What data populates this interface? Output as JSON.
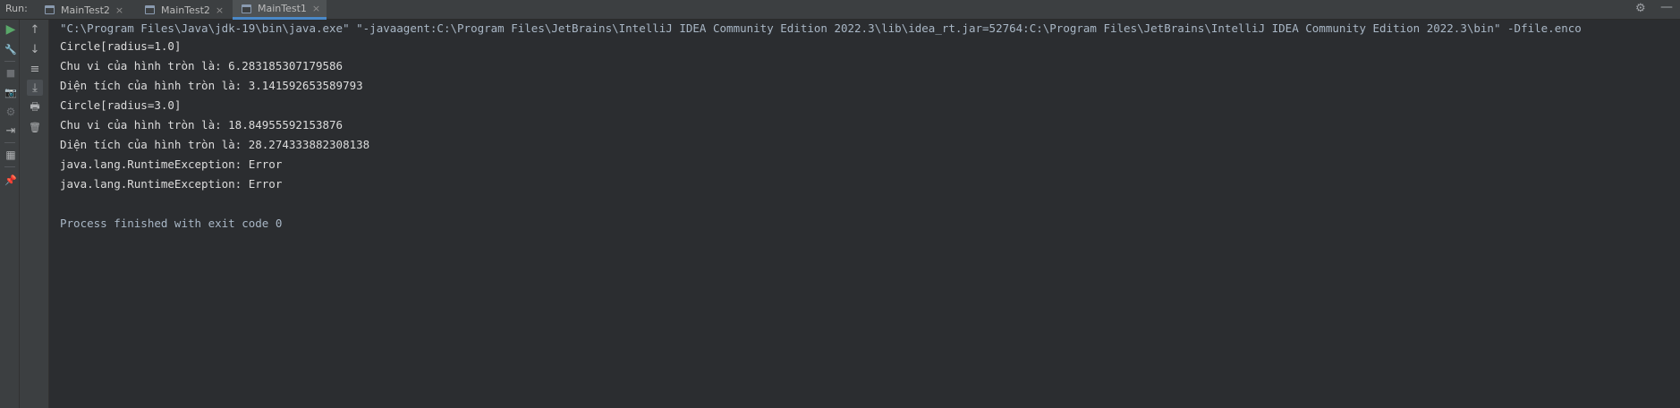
{
  "run_panel": {
    "label": "Run:",
    "tabs": [
      {
        "label": "MainTest2",
        "active": false
      },
      {
        "label": "MainTest2",
        "active": false
      },
      {
        "label": "MainTest1",
        "active": true
      }
    ],
    "close_glyph": "×",
    "gear_glyph": "⚙",
    "minimize_glyph": "—"
  },
  "toolbar_left": [
    {
      "name": "rerun-icon",
      "glyph": "▶"
    },
    {
      "name": "wrench-icon",
      "glyph": "🔧"
    },
    {
      "name": "stop-icon",
      "glyph": "■"
    },
    {
      "name": "camera-icon",
      "glyph": "📷"
    },
    {
      "name": "settings-icon",
      "glyph": "⚙"
    },
    {
      "name": "exit-icon",
      "glyph": "⇥"
    },
    {
      "name": "layout-icon",
      "glyph": "▦"
    },
    {
      "name": "pin-icon",
      "glyph": "📌"
    }
  ],
  "toolbar_right": [
    {
      "name": "up-arrow-icon",
      "glyph": "↑"
    },
    {
      "name": "down-arrow-icon",
      "glyph": "↓"
    },
    {
      "name": "soft-wrap-icon",
      "glyph": "≡"
    },
    {
      "name": "scroll-to-end-icon",
      "glyph": "⤓"
    },
    {
      "name": "print-icon",
      "glyph": "🖶"
    },
    {
      "name": "trash-icon",
      "glyph": "🗑"
    }
  ],
  "console": {
    "lines": [
      "\"C:\\Program Files\\Java\\jdk-19\\bin\\java.exe\" \"-javaagent:C:\\Program Files\\JetBrains\\IntelliJ IDEA Community Edition 2022.3\\lib\\idea_rt.jar=52764:C:\\Program Files\\JetBrains\\IntelliJ IDEA Community Edition 2022.3\\bin\" -Dfile.enco",
      "Circle[radius=1.0]",
      "Chu vi của hình tròn là: 6.283185307179586",
      "Diện tích của hình tròn là: 3.141592653589793",
      "Circle[radius=3.0]",
      "Chu vi của hình tròn là: 18.84955592153876",
      "Diện tích của hình tròn là: 28.274333882308138",
      "java.lang.RuntimeException: Error",
      "java.lang.RuntimeException: Error",
      "",
      "Process finished with exit code 0"
    ]
  },
  "colors": {
    "background": "#2b2d30",
    "toolbar": "#3c3f41",
    "text": "#dcdcdc",
    "active_tab_underline": "#4a88c7",
    "run_green": "#59a869"
  }
}
